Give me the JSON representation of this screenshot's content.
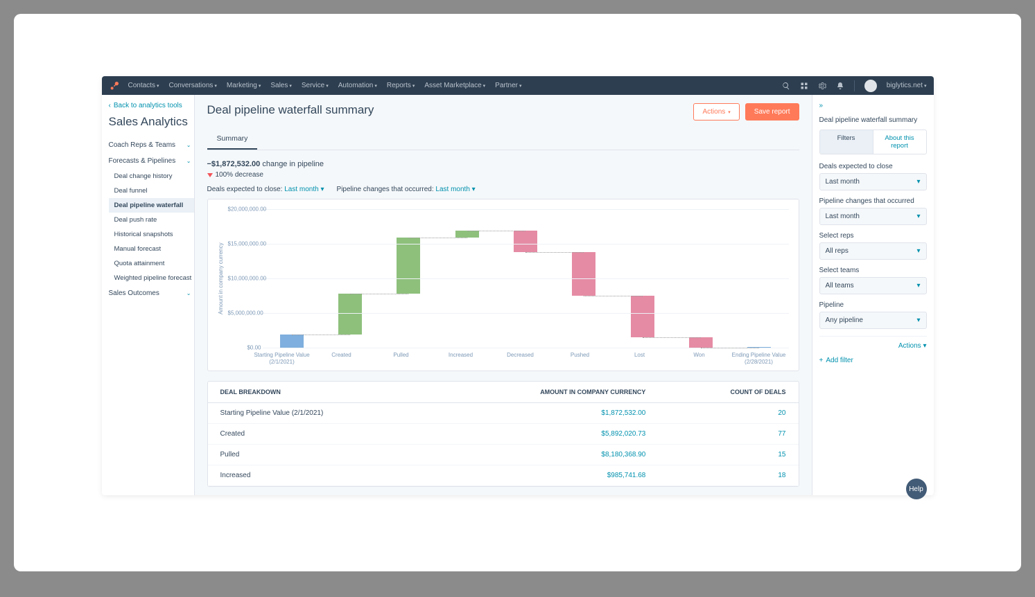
{
  "topbar": {
    "nav": [
      "Contacts",
      "Conversations",
      "Marketing",
      "Sales",
      "Service",
      "Automation",
      "Reports",
      "Asset Marketplace",
      "Partner"
    ],
    "account": "biglytics.net"
  },
  "sidebar": {
    "back": "Back to analytics tools",
    "title": "Sales Analytics",
    "groups": [
      {
        "label": "Coach Reps & Teams",
        "open": false,
        "items": []
      },
      {
        "label": "Forecasts & Pipelines",
        "open": true,
        "items": [
          "Deal change history",
          "Deal funnel",
          "Deal pipeline waterfall",
          "Deal push rate",
          "Historical snapshots",
          "Manual forecast",
          "Quota attainment",
          "Weighted pipeline forecast"
        ],
        "activeIndex": 2
      },
      {
        "label": "Sales Outcomes",
        "open": false,
        "items": []
      }
    ]
  },
  "main": {
    "title": "Deal pipeline waterfall summary",
    "actionsBtn": "Actions",
    "saveBtn": "Save report",
    "tab": "Summary",
    "changeValue": "−$1,872,532.00",
    "changeSuffix": " change in pipeline",
    "decreaseText": "100% decrease",
    "filter1Label": "Deals expected to close: ",
    "filter1Value": "Last month",
    "filter2Label": "Pipeline changes that occurred: ",
    "filter2Value": "Last month"
  },
  "chart_data": {
    "type": "waterfall",
    "ylabel": "Amount in company currency",
    "ylim": [
      0,
      20000000
    ],
    "yticks": [
      "$0.00",
      "$5,000,000.00",
      "$10,000,000.00",
      "$15,000,000.00",
      "$20,000,000.00"
    ],
    "categories": [
      "Starting Pipeline Value (2/1/2021)",
      "Created",
      "Pulled",
      "Increased",
      "Decreased",
      "Pushed",
      "Lost",
      "Won",
      "Ending Pipeline Value (2/28/2021)"
    ],
    "bars": [
      {
        "from": 0,
        "to": 1872532,
        "color": "blue"
      },
      {
        "from": 1872532,
        "to": 7764553,
        "color": "green"
      },
      {
        "from": 7764553,
        "to": 15944922,
        "color": "green"
      },
      {
        "from": 15944922,
        "to": 16930663,
        "color": "green"
      },
      {
        "from": 16930663,
        "to": 13800000,
        "color": "pink"
      },
      {
        "from": 13800000,
        "to": 7500000,
        "color": "pink"
      },
      {
        "from": 7500000,
        "to": 1500000,
        "color": "pink"
      },
      {
        "from": 1500000,
        "to": 0,
        "color": "pink"
      },
      {
        "from": 0,
        "to": 0,
        "color": "blue"
      }
    ]
  },
  "table": {
    "headers": [
      "DEAL BREAKDOWN",
      "AMOUNT IN COMPANY CURRENCY",
      "COUNT OF DEALS"
    ],
    "rows": [
      [
        "Starting Pipeline Value (2/1/2021)",
        "$1,872,532.00",
        "20"
      ],
      [
        "Created",
        "$5,892,020.73",
        "77"
      ],
      [
        "Pulled",
        "$8,180,368.90",
        "15"
      ],
      [
        "Increased",
        "$985,741.68",
        "18"
      ]
    ]
  },
  "rpanel": {
    "title": "Deal pipeline waterfall summary",
    "tabs": [
      "Filters",
      "About this report"
    ],
    "fields": [
      {
        "label": "Deals expected to close",
        "value": "Last month"
      },
      {
        "label": "Pipeline changes that occurred",
        "value": "Last month"
      },
      {
        "label": "Select reps",
        "value": "All reps"
      },
      {
        "label": "Select teams",
        "value": "All teams"
      },
      {
        "label": "Pipeline",
        "value": "Any pipeline"
      }
    ],
    "actions": "Actions",
    "addFilter": "Add filter"
  },
  "help": "Help"
}
